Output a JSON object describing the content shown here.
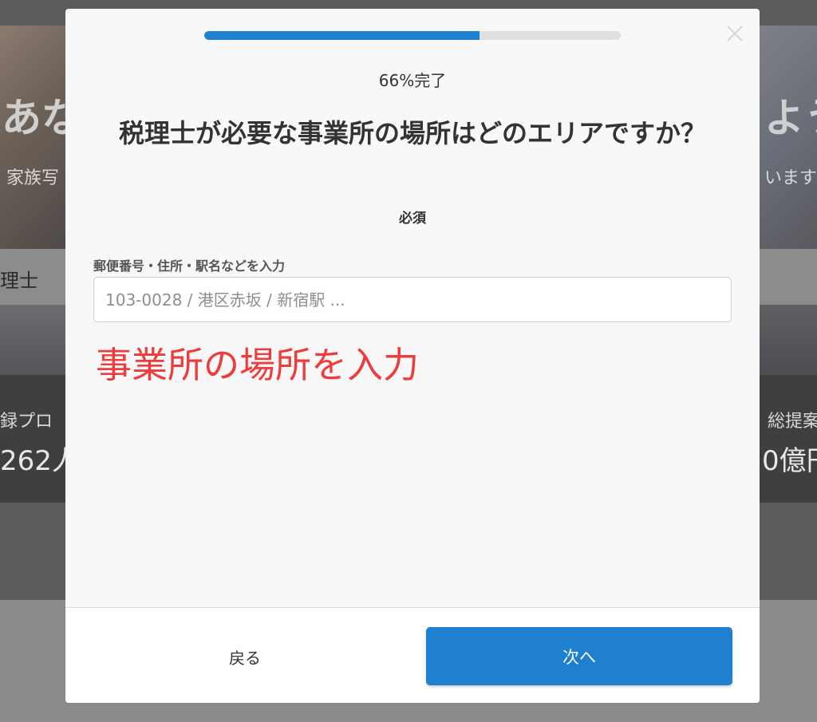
{
  "background": {
    "hero_left_text": "あな",
    "hero_right_text": "よう",
    "hero_sub_left": "家族写",
    "hero_sub_right": "います",
    "strip_text": "理士",
    "stat_left_label": "録プロ",
    "stat_left_value": "262人",
    "stat_right_label": "総提案",
    "stat_right_value": "0億円"
  },
  "modal": {
    "progress_percent": 66,
    "progress_text": "66%完了",
    "question": "税理士が必要な事業所の場所はどのエリアですか？",
    "required_label": "必須",
    "field_label": "郵便番号・住所・駅名などを入力",
    "field_placeholder": "103-0028 / 港区赤坂 / 新宿駅 ...",
    "field_value": "",
    "annotation": "事業所の場所を入力",
    "back_label": "戻る",
    "next_label": "次へ",
    "close_icon": "close-icon"
  },
  "colors": {
    "accent": "#1f80d0",
    "annotation": "#ee3b3b",
    "overlay": "#5b5b5b"
  }
}
